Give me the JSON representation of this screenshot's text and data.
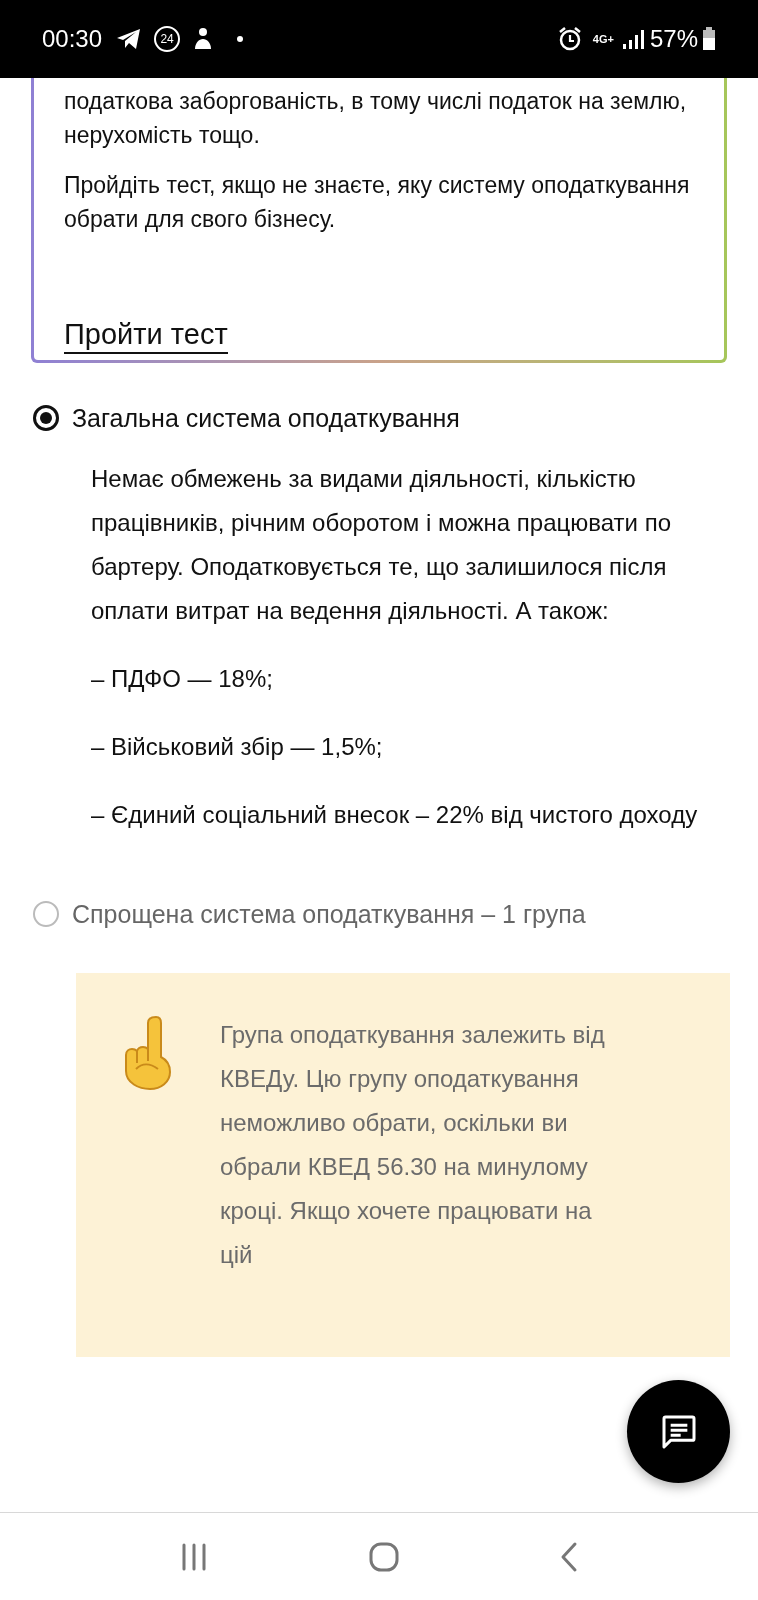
{
  "status_bar": {
    "time": "00:30",
    "notification_badge": "24",
    "network": "4G+",
    "battery": "57%"
  },
  "info_card": {
    "paragraphs": [
      "податкова заборгованість, в тому числі податок на землю, нерухомість тощо.",
      "Пройдіть тест, якщо не знаєте, яку систему оподаткування обрати для свого бізнесу."
    ],
    "link": "Пройти тест"
  },
  "options": [
    {
      "label": "Загальна система оподаткування",
      "selected": true,
      "description": [
        "Немає обмежень за видами діяльності, кількістю працівників, річним оборотом і можна працювати по бартеру. Оподатковується те, що залишилося після оплати витрат на ведення діяльності. А також:",
        "– ПДФО — 18%;",
        "– Військовий збір — 1,5%;",
        "– Єдиний соціальний внесок – 22% від чистого доходу"
      ]
    },
    {
      "label": "Спрощена система оподаткування – 1 група",
      "selected": false,
      "note": "Група оподаткування залежить від КВЕДу. Цю групу оподаткування неможливо обрати, оскільки ви обрали КВЕД 56.30 на минулому кроці. Якщо хочете працювати на цій"
    }
  ]
}
